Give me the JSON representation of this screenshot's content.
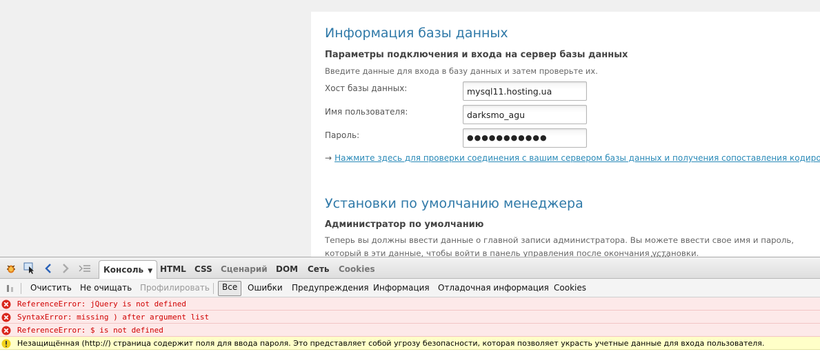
{
  "db_section": {
    "title": "Информация базы данных",
    "subtitle": "Параметры подключения и входа на сервер базы данных",
    "description": "Введите данные для входа в базу данных и затем проверьте их.",
    "host_label": "Хост базы данных:",
    "host_value": "mysql11.hosting.ua",
    "user_label": "Имя пользователя:",
    "user_value": "darksmo_agu",
    "password_label": "Пароль:",
    "password_value": "●●●●●●●●●●●",
    "arrow": "→",
    "test_link": "Нажмите здесь для проверки соединения с вашим сервером базы данных и получения сопоставления кодировки"
  },
  "manager_section": {
    "title": "Установки по умолчанию менеджера",
    "subtitle": "Администратор по умолчанию",
    "paragraph": "Теперь вы должны ввести данные о главной записи администратора. Вы можете ввести свое имя и пароль, который в эти данные, чтобы войти в панель управления после окончания установки."
  },
  "firebug": {
    "tabs": {
      "console": "Консоль",
      "html": "HTML",
      "css": "CSS",
      "script": "Сценарий",
      "dom": "DOM",
      "net": "Сеть",
      "cookies": "Cookies"
    },
    "toolbar": {
      "clear": "Очистить",
      "persist": "Не очищать",
      "profile": "Профилировать",
      "all": "Все",
      "errors": "Ошибки",
      "warnings": "Предупреждения",
      "info": "Информация",
      "debug": "Отладочная информация",
      "cookies": "Cookies"
    },
    "messages": [
      {
        "type": "error",
        "text": "ReferenceError: jQuery is not defined"
      },
      {
        "type": "error",
        "text": "SyntaxError: missing ) after argument list"
      },
      {
        "type": "error",
        "text": "ReferenceError: $ is not defined"
      },
      {
        "type": "warning",
        "text": "Незащищённая (http://) страница содержит поля для ввода пароля. Это представляет собой угрозу безопасности, которая позволяет украсть учетные данные для входа пользователя."
      }
    ]
  },
  "colors": {
    "heading": "#2f79a8",
    "link": "#2a8ab8",
    "error_text": "#d00000",
    "error_bg": "#fde9e9",
    "warning_bg": "#ffffc8"
  }
}
